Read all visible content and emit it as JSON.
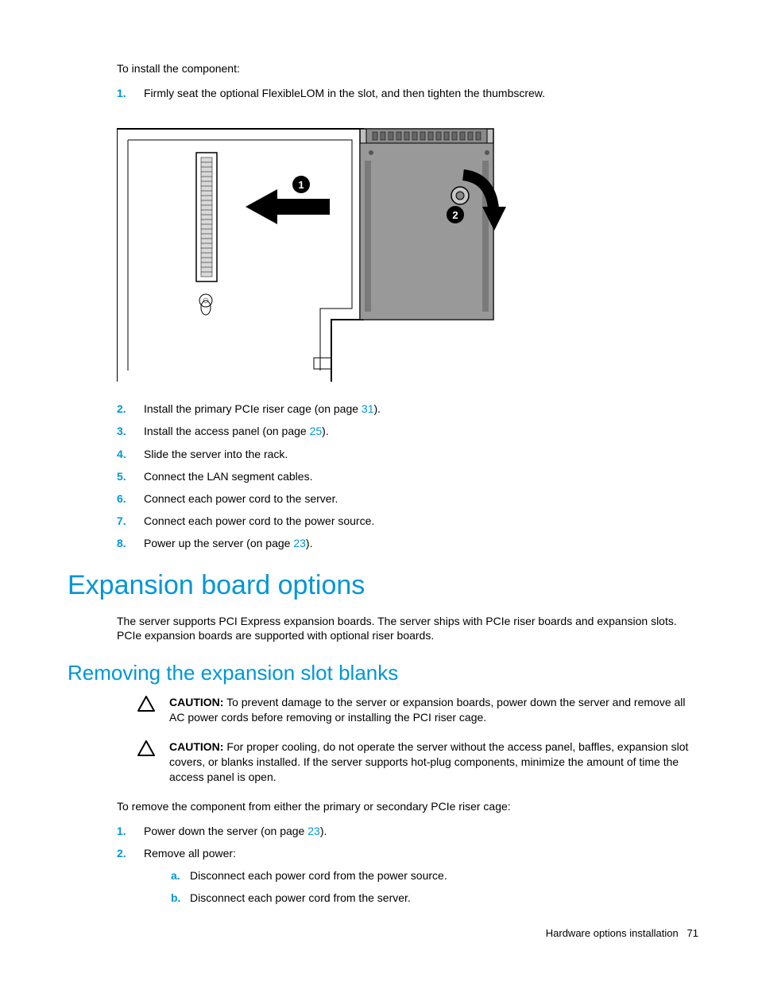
{
  "intro": "To install the component:",
  "steps_top": {
    "s1": "Firmly seat the optional FlexibleLOM in the slot, and then tighten the thumbscrew."
  },
  "steps_bottom": {
    "s2_pre": "Install the primary PCIe riser cage (on page ",
    "s2_link": "31",
    "s2_post": ").",
    "s3_pre": "Install the access panel (on page ",
    "s3_link": "25",
    "s3_post": ").",
    "s4": "Slide the server into the rack.",
    "s5": "Connect the LAN segment cables.",
    "s6": "Connect each power cord to the server.",
    "s7": "Connect each power cord to the power source.",
    "s8_pre": "Power up the server (on page ",
    "s8_link": "23",
    "s8_post": ")."
  },
  "heading1": "Expansion board options",
  "para1": "The server supports PCI Express expansion boards. The server ships with PCIe riser boards and expansion slots. PCIe expansion boards are supported with optional riser boards.",
  "heading2": "Removing the expansion slot blanks",
  "caution1": {
    "label": "CAUTION:",
    "text": "  To prevent damage to the server or expansion boards, power down the server and remove all AC power cords before removing or installing the PCI riser cage."
  },
  "caution2": {
    "label": "CAUTION:",
    "text": "  For proper cooling, do not operate the server without the access panel, baffles, expansion slot covers, or blanks installed. If the server supports hot-plug components, minimize the amount of time the access panel is open."
  },
  "para2": "To remove the component from either the primary or secondary PCIe riser cage:",
  "remove_steps": {
    "s1_pre": "Power down the server (on page ",
    "s1_link": "23",
    "s1_post": ").",
    "s2": "Remove all power:",
    "s2a": "Disconnect each power cord from the power source.",
    "s2b": "Disconnect each power cord from the server."
  },
  "footer": {
    "section": "Hardware options installation",
    "page": "71"
  }
}
